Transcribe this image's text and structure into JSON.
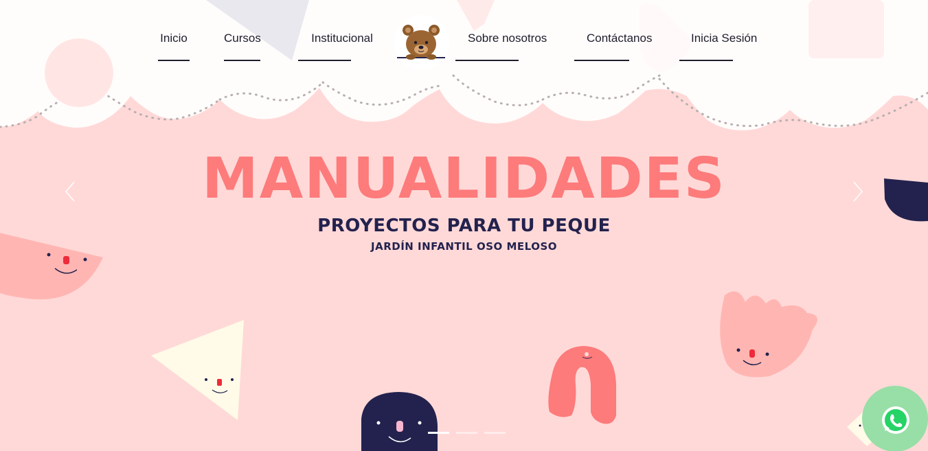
{
  "nav": {
    "items": [
      {
        "label": "Inicio"
      },
      {
        "label": "Cursos"
      },
      {
        "label": "Institucional"
      },
      {
        "label": "Sobre nosotros"
      },
      {
        "label": "Contáctanos"
      },
      {
        "label": "Inicia Sesión"
      }
    ],
    "logo_icon": "teddy-bear-icon"
  },
  "hero": {
    "title": "MANUALIDADES",
    "subtitle": "PROYECTOS PARA TU PEQUE",
    "tagline": "JARDÍN INFANTIL OSO MELOSO",
    "slides": 3,
    "active_slide": 0
  },
  "colors": {
    "background": "#ffd9d8",
    "title": "#fd7b7b",
    "dark": "#23224e",
    "cloud": "#fffdfc",
    "whatsapp": "#25d366"
  },
  "icons": {
    "prev": "chevron-left-icon",
    "next": "chevron-right-icon",
    "chat": "whatsapp-icon"
  }
}
